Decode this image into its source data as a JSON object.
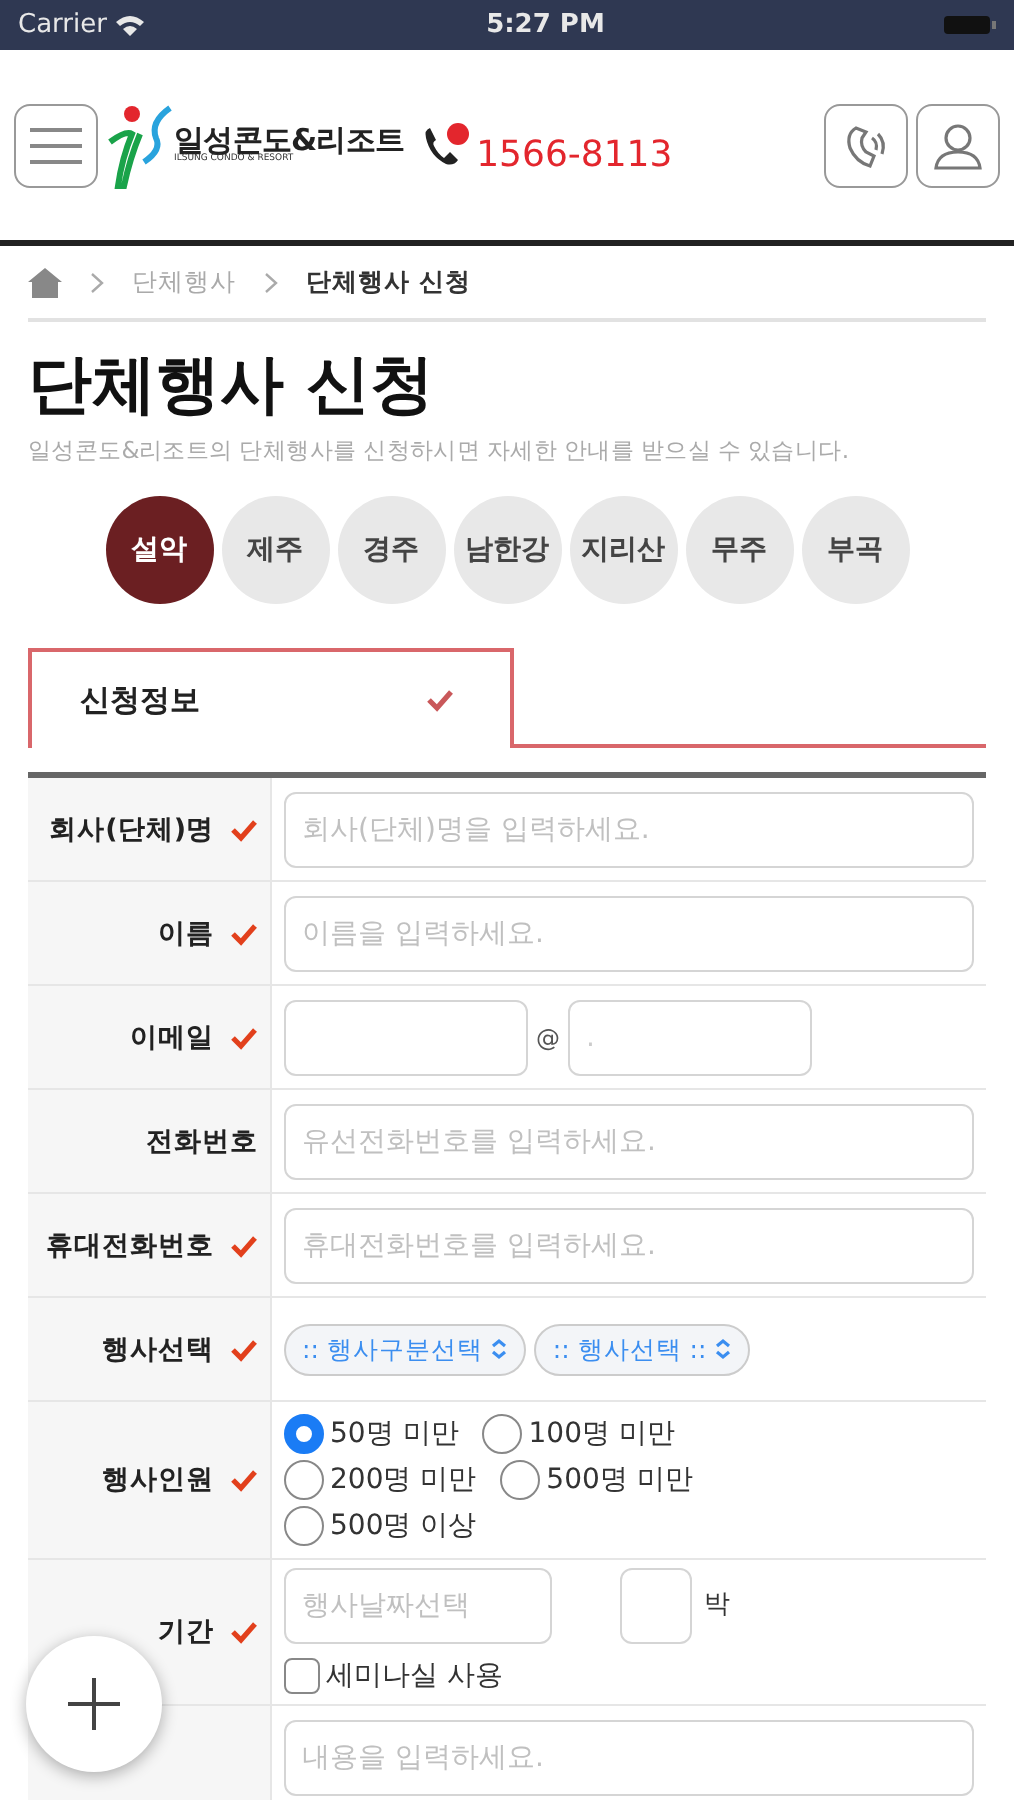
{
  "status_bar": {
    "carrier": "Carrier",
    "time": "5:27 PM"
  },
  "header": {
    "logo_text": "일성콘도&리조트",
    "logo_subtext": "ILSUNG CONDO & RESORT",
    "phone": "1566-8113"
  },
  "breadcrumb": [
    "단체행사",
    "단체행사 신청"
  ],
  "title": "단체행사 신청",
  "subtitle": "일성콘도&리조트의 단체행사를 신청하시면 자세한 안내를 받으실 수 있습니다.",
  "locations": [
    {
      "label": "설악",
      "selected": true
    },
    {
      "label": "제주",
      "selected": false
    },
    {
      "label": "경주",
      "selected": false
    },
    {
      "label": "남한강",
      "selected": false
    },
    {
      "label": "지리산",
      "selected": false
    },
    {
      "label": "무주",
      "selected": false
    },
    {
      "label": "부곡",
      "selected": false
    }
  ],
  "tab": {
    "label": "신청정보",
    "checked": true
  },
  "form": [
    {
      "kind": "text",
      "label": "회사(단체)명",
      "required": true,
      "placeholder": "회사(단체)명을 입력하세요."
    },
    {
      "kind": "text",
      "label": "이름",
      "required": true,
      "placeholder": "이름을 입력하세요."
    },
    {
      "kind": "email",
      "label": "이메일",
      "required": true,
      "at": "@",
      "domain_value": "."
    },
    {
      "kind": "text",
      "label": "전화번호",
      "required": false,
      "placeholder": "유선전화번호를 입력하세요."
    },
    {
      "kind": "text",
      "label": "휴대전화번호",
      "required": true,
      "placeholder": "휴대전화번호를 입력하세요."
    },
    {
      "kind": "select",
      "label": "행사선택",
      "required": true,
      "selects": [
        ":: 행사구분선택",
        ":: 행사선택 ::"
      ]
    },
    {
      "kind": "radio",
      "label": "행사인원",
      "required": true,
      "options": [
        {
          "label": "50명 미만",
          "selected": true
        },
        {
          "label": "100명 미만",
          "selected": false
        },
        {
          "label": "200명 미만",
          "selected": false
        },
        {
          "label": "500명 미만",
          "selected": false
        },
        {
          "label": "500명 이상",
          "selected": false
        }
      ]
    },
    {
      "kind": "period",
      "label": "기간",
      "required": true,
      "placeholder": "행사날짜선택",
      "nights_unit": "박",
      "checkbox": {
        "label": "세미나실 사용",
        "checked": false
      }
    },
    {
      "kind": "textarea",
      "required": false,
      "placeholder": "내용을 입력하세요."
    }
  ]
}
